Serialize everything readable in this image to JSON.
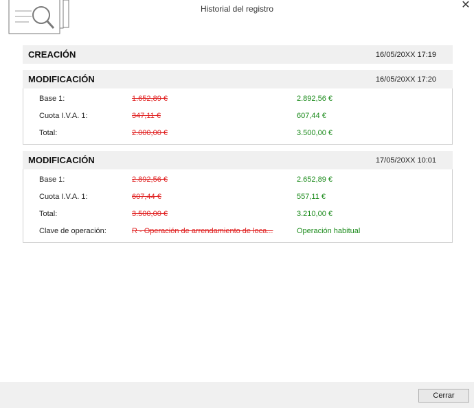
{
  "window": {
    "title": "Historial del registro",
    "close_glyph": "✕"
  },
  "entries": [
    {
      "title": "CREACIÓN",
      "datetime": "16/05/20XX 17:19",
      "rows": []
    },
    {
      "title": "MODIFICACIÓN",
      "datetime": "16/05/20XX 17:20",
      "rows": [
        {
          "label": "Base 1:",
          "old": "1.652,89 €",
          "new": "2.892,56 €"
        },
        {
          "label": "Cuota I.V.A. 1:",
          "old": "347,11 €",
          "new": "607,44 €"
        },
        {
          "label": "Total:",
          "old": "2.000,00 €",
          "new": "3.500,00 €"
        }
      ]
    },
    {
      "title": "MODIFICACIÓN",
      "datetime": "17/05/20XX 10:01",
      "rows": [
        {
          "label": "Base 1:",
          "old": "2.892,56 €",
          "new": "2.652,89 €"
        },
        {
          "label": "Cuota I.V.A. 1:",
          "old": "607,44 €",
          "new": "557,11 €"
        },
        {
          "label": "Total:",
          "old": "3.500,00 €",
          "new": "3.210,00 €"
        },
        {
          "label": "Clave de operación:",
          "old": "R - Operación de arrendamiento de loca...",
          "new": "Operación habitual"
        }
      ]
    }
  ],
  "footer": {
    "close_label": "Cerrar"
  },
  "colors": {
    "old_value": "#e02020",
    "new_value": "#1a8a1a",
    "header_bg": "#f0f0f0"
  },
  "icons": {
    "logo": "document-search-icon",
    "close": "close-icon"
  }
}
